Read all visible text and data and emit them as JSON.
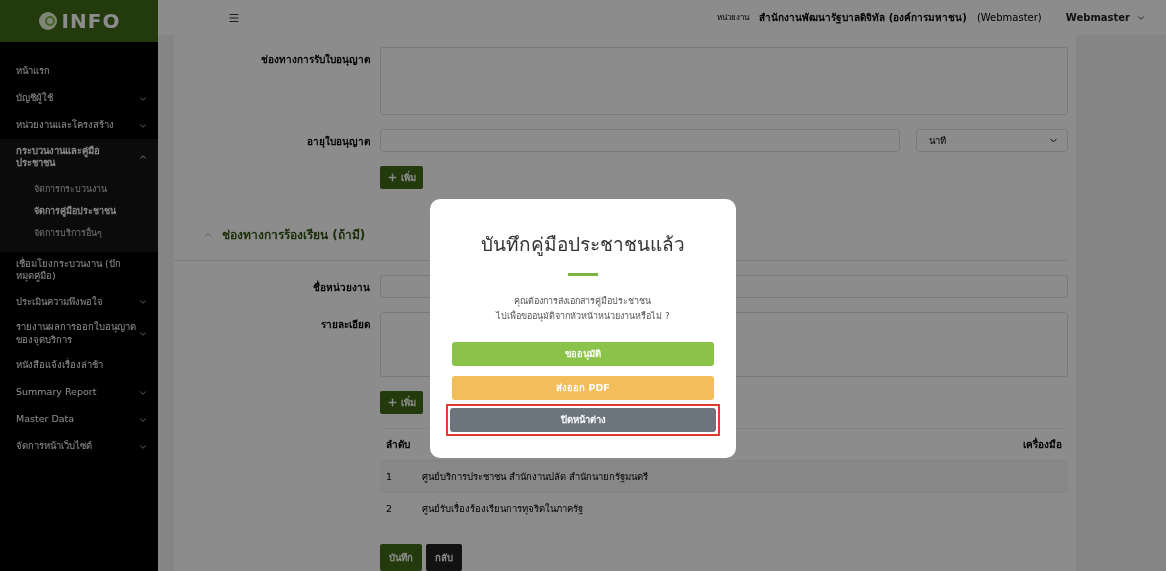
{
  "logo": {
    "text": "INFO"
  },
  "header": {
    "unit_label": "หน่วยงาน",
    "unit_name": "สำนักงานพัฒนารัฐบาลดิจิทัล (องค์การมหาชน)",
    "role": "(Webmaster)",
    "user": "Webmaster"
  },
  "sidebar": {
    "items": [
      {
        "label": "หน้าแรก",
        "expandable": false,
        "expanded": false
      },
      {
        "label": "บัญชีผู้ใช้",
        "expandable": true,
        "expanded": false
      },
      {
        "label": "หน่วยงานและโครงสร้าง",
        "expandable": true,
        "expanded": false
      },
      {
        "label": "กระบวนงานและคู่มือประชาชน",
        "expandable": true,
        "expanded": true,
        "children": [
          {
            "label": "จัดการกระบวนงาน",
            "selected": false
          },
          {
            "label": "จัดการคู่มือประชาชน",
            "selected": true
          },
          {
            "label": "จัดการบริการอื่นๆ",
            "selected": false
          }
        ]
      },
      {
        "label": "เชื่อมโยงกระบวนงาน (ปักหมุดคู่มือ)",
        "expandable": false,
        "expanded": false
      },
      {
        "label": "ประเมินความพึงพอใจ",
        "expandable": true,
        "expanded": false
      },
      {
        "label": "รายงานผลการออกใบอนุญาตของจุดบริการ",
        "expandable": true,
        "expanded": false
      },
      {
        "label": "หนังสือแจ้งเรื่องล่าช้า",
        "expandable": false,
        "expanded": false
      },
      {
        "label": "Summary Report",
        "expandable": true,
        "expanded": false
      },
      {
        "label": "Master Data",
        "expandable": true,
        "expanded": false
      },
      {
        "label": "จัดการหน้าเว็บไซต์",
        "expandable": true,
        "expanded": false
      }
    ]
  },
  "license_form": {
    "rows": [
      {
        "kind": "textarea",
        "label": "ช่องทางการรับใบอนุญาต"
      },
      {
        "kind": "input-select",
        "label": "อายุใบอนุญาต",
        "select_value": "นาที"
      },
      {
        "kind": "add",
        "button": "เพิ่ม"
      }
    ]
  },
  "complaint_section": {
    "title": "ช่องทางการร้องเรียน (ถ้ามี)",
    "expanded": true,
    "rows": [
      {
        "kind": "input",
        "label": "ชื่อหน่วยงาน"
      },
      {
        "kind": "textarea",
        "label": "รายละเอียด"
      },
      {
        "kind": "add",
        "button": "เพิ่ม"
      }
    ],
    "table": {
      "index_header": "ลำดับ",
      "tools_header": "เครื่องมือ",
      "rows": [
        {
          "index": "1",
          "name": "ศูนย์บริการประชาชน สำนักงานปลัด สำนักนายกรัฐมนตรี"
        },
        {
          "index": "2",
          "name": "ศูนย์รับเรื่องร้องเรียนการทุจริตในภาครัฐ"
        }
      ]
    }
  },
  "actions": [
    {
      "kind": "save",
      "label": "บันทึก"
    },
    {
      "kind": "back",
      "label": "กลับ"
    }
  ],
  "modal": {
    "title": "บันทึกคู่มือประชาชนแล้ว",
    "message": [
      "คุณต้องการส่งเอกสารคู่มือประชาชน",
      "ไปเพื่อขออนุมัติจากหัวหน้าหน่วยงานหรือไม่ ?"
    ],
    "buttons": [
      {
        "kind": "approve",
        "label": "ขออนุมัติ",
        "highlighted": false
      },
      {
        "kind": "export",
        "label": "ส่งออก PDF",
        "highlighted": false
      },
      {
        "kind": "close",
        "label": "ปิดหน้าต่าง",
        "highlighted": true
      }
    ]
  }
}
